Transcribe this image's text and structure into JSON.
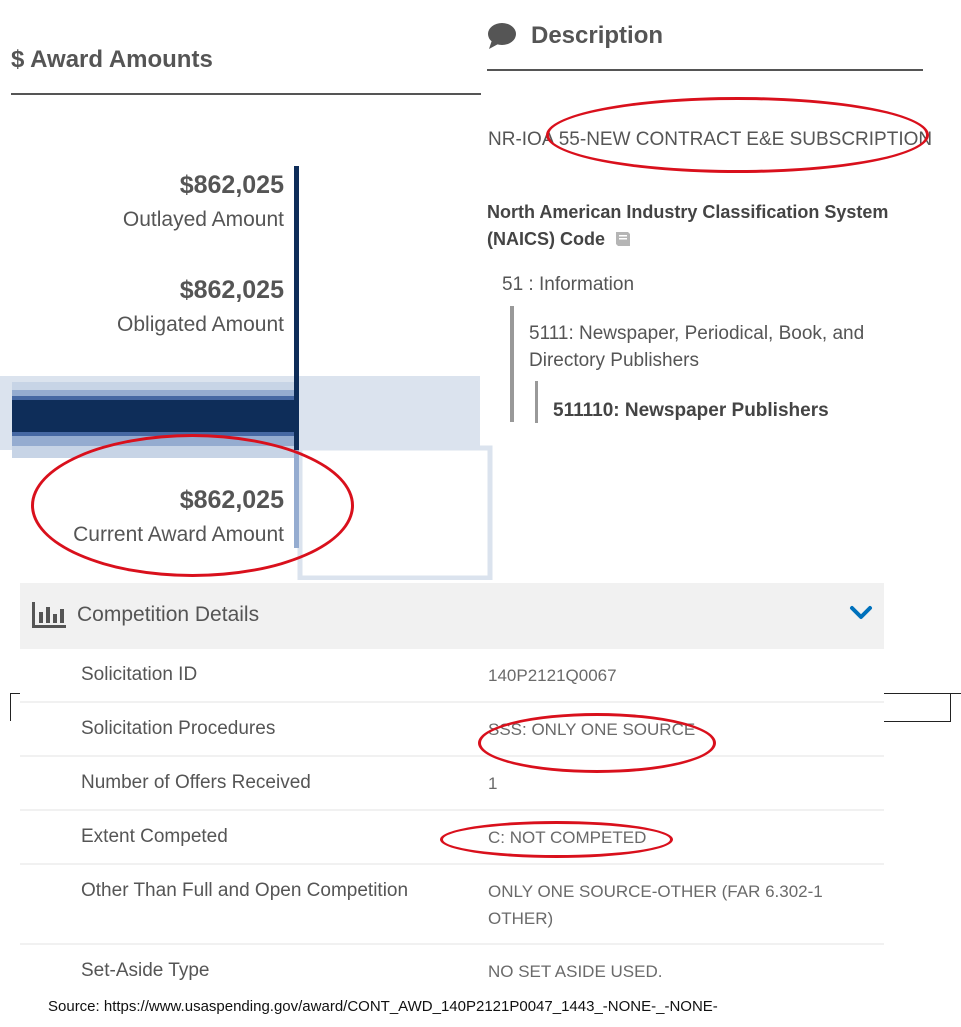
{
  "award_amounts": {
    "title": "$ Award Amounts",
    "outlayed": {
      "value": "$862,025",
      "label": "Outlayed Amount"
    },
    "obligated": {
      "value": "$862,025",
      "label": "Obligated Amount"
    },
    "current": {
      "value": "$862,025",
      "label": "Current Award Amount"
    }
  },
  "description": {
    "title": "Description",
    "icon": "speech-bubble-icon",
    "text": "NR-IOA 55-NEW CONTRACT E&E SUBSCRIPTION",
    "naics_title_line1": "North American Industry Classification System",
    "naics_title_line2": "(NAICS)  Code",
    "naics_icon": "book-icon",
    "level1": "51 : Information",
    "level2_line1": "5111: Newspaper, Periodical, Book, and",
    "level2_line2": "Directory Publishers",
    "level3": "511110: Newspaper Publishers"
  },
  "competition": {
    "title": "Competition Details",
    "icon": "bar-chart-icon",
    "toggle_icon": "chevron-down-icon",
    "accent": "#0071bc",
    "rows": [
      {
        "label": "Solicitation ID",
        "value": "140P2121Q0067"
      },
      {
        "label": "Solicitation Procedures",
        "value": "SSS: ONLY ONE SOURCE"
      },
      {
        "label": "Number of Offers Received",
        "value": "1"
      },
      {
        "label": "Extent Competed",
        "value": "C: NOT COMPETED"
      },
      {
        "label": "Other Than Full and Open Competition",
        "value": "ONLY ONE SOURCE-OTHER (FAR 6.302-1 OTHER)"
      },
      {
        "label": "Set-Aside Type",
        "value": "NO SET ASIDE USED."
      }
    ]
  },
  "source": "Source: https://www.usaspending.gov/award/CONT_AWD_140P2121P0047_1443_-NONE-_-NONE-",
  "colors": {
    "annotation_red": "#d9101c",
    "bar_dark": "#0e2d59",
    "bar_light": "#dbe3ee"
  }
}
